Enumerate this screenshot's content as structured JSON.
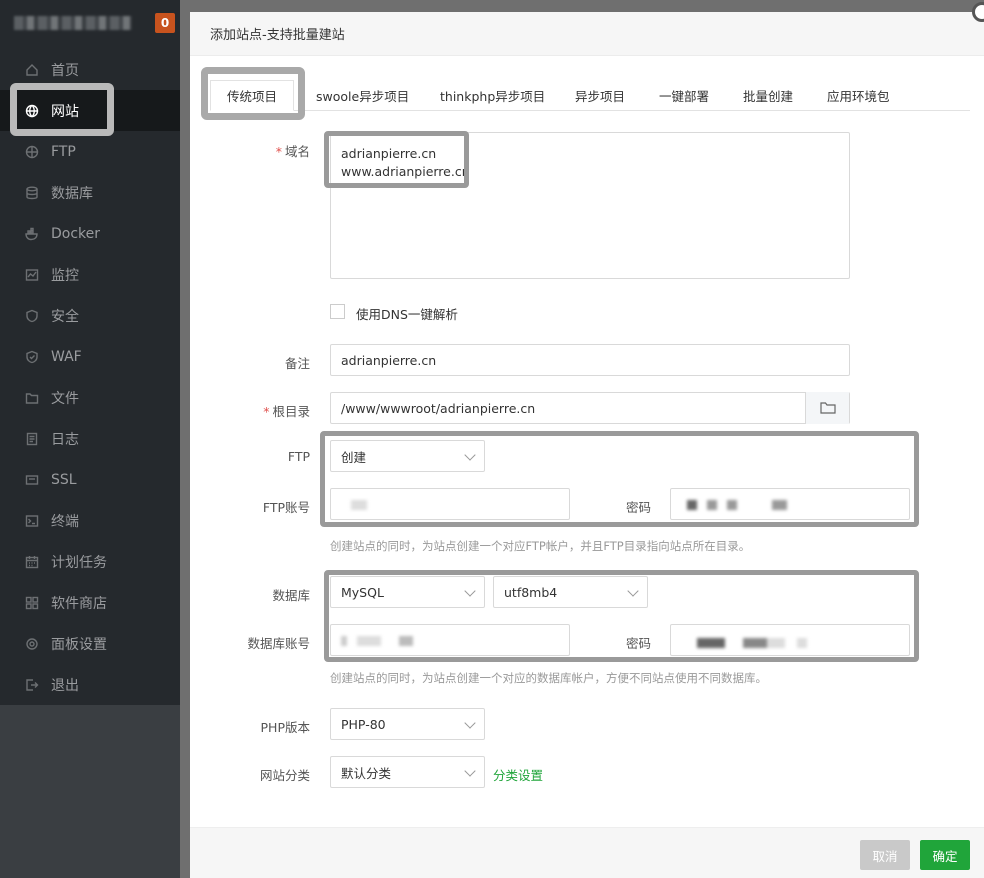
{
  "sidebar": {
    "badge": "0",
    "items": [
      {
        "label": "首页",
        "icon": "home-icon"
      },
      {
        "label": "网站",
        "icon": "globe-icon"
      },
      {
        "label": "FTP",
        "icon": "ftp-icon"
      },
      {
        "label": "数据库",
        "icon": "database-icon"
      },
      {
        "label": "Docker",
        "icon": "docker-icon"
      },
      {
        "label": "监控",
        "icon": "monitor-icon"
      },
      {
        "label": "安全",
        "icon": "shield-icon"
      },
      {
        "label": "WAF",
        "icon": "waf-shield-icon"
      },
      {
        "label": "文件",
        "icon": "folder-icon"
      },
      {
        "label": "日志",
        "icon": "log-icon"
      },
      {
        "label": "SSL",
        "icon": "ssl-icon"
      },
      {
        "label": "终端",
        "icon": "terminal-icon"
      },
      {
        "label": "计划任务",
        "icon": "calendar-icon"
      },
      {
        "label": "软件商店",
        "icon": "store-icon"
      },
      {
        "label": "面板设置",
        "icon": "gear-icon"
      },
      {
        "label": "退出",
        "icon": "logout-icon"
      }
    ]
  },
  "dialog": {
    "title": "添加站点-支持批量建站",
    "tabs": [
      "传统项目",
      "swoole异步项目",
      "thinkphp异步项目",
      "异步项目",
      "一键部署",
      "批量创建",
      "应用环境包"
    ],
    "form": {
      "domain_label": "域名",
      "domain_lines": [
        "adrianpierre.cn",
        "www.adrianpierre.cn"
      ],
      "dns_label": "使用DNS一键解析",
      "remark_label": "备注",
      "remark_value": "adrianpierre.cn",
      "root_label": "根目录",
      "root_value": "/www/wwwroot/adrianpierre.cn",
      "ftp_label": "FTP",
      "ftp_select": "创建",
      "ftp_account_label": "FTP账号",
      "ftp_password_label": "密码",
      "ftp_hint": "创建站点的同时，为站点创建一个对应FTP帐户，并且FTP目录指向站点所在目录。",
      "db_label": "数据库",
      "db_select": "MySQL",
      "db_charset": "utf8mb4",
      "db_account_label": "数据库账号",
      "db_password_label": "密码",
      "db_hint": "创建站点的同时，为站点创建一个对应的数据库帐户，方便不同站点使用不同数据库。",
      "php_label": "PHP版本",
      "php_value": "PHP-80",
      "category_label": "网站分类",
      "category_value": "默认分类",
      "category_link": "分类设置"
    },
    "buttons": {
      "cancel": "取消",
      "confirm": "确定"
    }
  }
}
